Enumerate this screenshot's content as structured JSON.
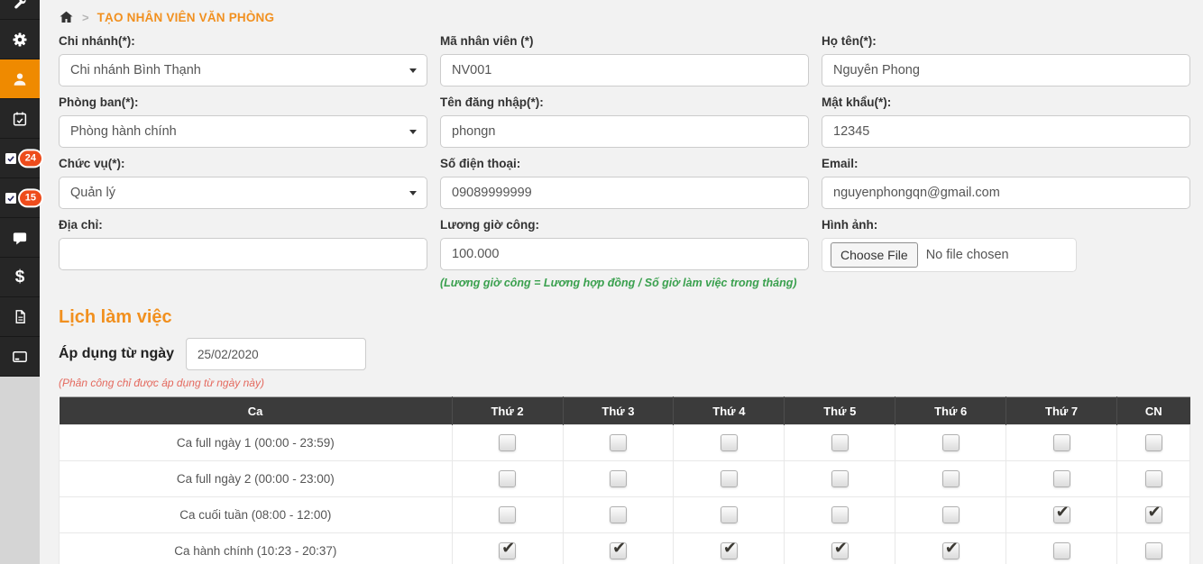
{
  "colors": {
    "accent_orange": "#ef8a00",
    "breadcrumb_orange": "#f1901f",
    "sidebar_bg": "#262626",
    "badge_red": "#ee4c1c",
    "table_header_bg": "#3b3b3b",
    "note_green": "#3aa04e",
    "note_red": "#e4695e",
    "page_bg": "#f2f2f2"
  },
  "breadcrumb": {
    "title": "TẠO NHÂN VIÊN VĂN PHÒNG"
  },
  "sidebar": {
    "icons": [
      "wrench-icon",
      "gear-icon",
      "user-icon",
      "calendar-check-icon",
      "checkin-square-icon",
      "checkout-square-icon",
      "chat-icon",
      "dollar-icon",
      "document-icon",
      "credit-card-icon"
    ],
    "active_index": 2,
    "badges": {
      "checkin": "24",
      "checkout": "15"
    }
  },
  "form": {
    "fields": [
      {
        "label": "Chi nhánh(*):",
        "value": "Chi nhánh Bình Thạnh",
        "type": "select"
      },
      {
        "label": "Mã nhân viên (*)",
        "value": "NV001",
        "type": "text"
      },
      {
        "label": "Họ tên(*):",
        "value": "Nguyễn Phong",
        "type": "text"
      },
      {
        "label": "Phòng ban(*):",
        "value": "Phòng hành chính",
        "type": "select"
      },
      {
        "label": "Tên đăng nhập(*):",
        "value": "phongn",
        "type": "text"
      },
      {
        "label": "Mật khẩu(*):",
        "value": "12345",
        "type": "text"
      },
      {
        "label": "Chức vụ(*):",
        "value": "Quản lý",
        "type": "select"
      },
      {
        "label": "Số điện thoại:",
        "value": "09089999999",
        "type": "text"
      },
      {
        "label": "Email:",
        "value": "nguyenphongqn@gmail.com",
        "type": "text"
      },
      {
        "label": "Địa chỉ:",
        "value": "",
        "type": "text"
      },
      {
        "label": "Lương giờ công:",
        "value": "100.000",
        "type": "text",
        "note": "(Lương giờ công = Lương hợp đồng / Số giờ làm việc trong tháng)"
      },
      {
        "label": "Hình ảnh:",
        "type": "file",
        "button": "Choose File",
        "status": "No file chosen"
      }
    ]
  },
  "schedule": {
    "heading": "Lịch làm việc",
    "apply_label": "Áp dụng từ ngày",
    "apply_date": "25/02/2020",
    "note": "(Phân công chỉ được áp dụng từ ngày này)",
    "table": {
      "shift_header": "Ca",
      "day_headers": [
        "Thứ 2",
        "Thứ 3",
        "Thứ 4",
        "Thứ 5",
        "Thứ 6",
        "Thứ 7",
        "CN"
      ],
      "rows": [
        {
          "label": "Ca full ngày 1 (00:00 - 23:59)",
          "checks": [
            false,
            false,
            false,
            false,
            false,
            false,
            false
          ]
        },
        {
          "label": "Ca full ngày 2 (00:00 - 23:00)",
          "checks": [
            false,
            false,
            false,
            false,
            false,
            false,
            false
          ]
        },
        {
          "label": "Ca cuối tuần (08:00 - 12:00)",
          "checks": [
            false,
            false,
            false,
            false,
            false,
            true,
            true
          ]
        },
        {
          "label": "Ca hành chính (10:23 - 20:37)",
          "checks": [
            true,
            true,
            true,
            true,
            true,
            false,
            false
          ]
        }
      ]
    }
  }
}
